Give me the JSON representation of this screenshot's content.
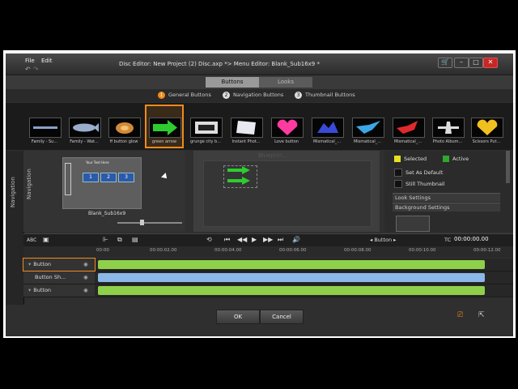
{
  "menu": {
    "file": "File",
    "edit": "Edit"
  },
  "window_title": "Disc Editor: New Project (2) Disc.axp  *>  Menu Editor: Blank_Sub16x9  *",
  "window_controls": {
    "cart": "🛒",
    "minimize": "–",
    "maximize": "□",
    "close": "✕"
  },
  "tabs": [
    {
      "label": "Buttons",
      "active": true
    },
    {
      "label": "Looks",
      "active": false
    }
  ],
  "categories": [
    {
      "num": "1",
      "label": "General Buttons",
      "active": true
    },
    {
      "num": "2",
      "label": "Navigation Buttons",
      "active": false
    },
    {
      "num": "3",
      "label": "Thumbnail Buttons",
      "active": false
    }
  ],
  "gallery": [
    {
      "label": "Family - Su...",
      "icon": "line-icon",
      "color": "#8aa0c8"
    },
    {
      "label": "Family - Wat...",
      "icon": "fish-icon",
      "color": "#9aaccc"
    },
    {
      "label": "ff button glow",
      "icon": "glow-icon",
      "color": "#d08a3a"
    },
    {
      "label": "green arrow",
      "icon": "arrow-icon",
      "color": "#2ecc2e",
      "selected": true
    },
    {
      "label": "grunge city b...",
      "icon": "grunge-icon",
      "color": "#dddddd"
    },
    {
      "label": "Instant Phot...",
      "icon": "photo-icon",
      "color": "#e8e8f0"
    },
    {
      "label": "Love button",
      "icon": "heart-icon",
      "color": "#ff3aa0"
    },
    {
      "label": "Mismatical_...",
      "icon": "splash-icon",
      "color": "#3a4ad8"
    },
    {
      "label": "Mismatical_...",
      "icon": "bird-icon",
      "color": "#3aa8e8"
    },
    {
      "label": "Mismatical_...",
      "icon": "bird-icon",
      "color": "#e02a2a"
    },
    {
      "label": "Photo Album...",
      "icon": "plane-icon",
      "color": "#dddddd"
    },
    {
      "label": "Scissors Put...",
      "icon": "heart-icon",
      "color": "#f0c020"
    }
  ],
  "left_sidebar": {
    "label": "Navigation"
  },
  "nav_panel": {
    "label": "Navigation",
    "preview_title": "Your Text Here",
    "slots": [
      "1",
      "2",
      "3"
    ],
    "thumb_name": "Blank_Sub16x9"
  },
  "stage": {
    "watermark": "Blueprin..."
  },
  "properties": {
    "selected": "Selected",
    "active": "Active",
    "selected_color": "#e8e020",
    "active_color": "#2ea82e",
    "set_default": "Set As Default",
    "still_thumbnail": "Still Thumbnail",
    "look_settings": "Look Settings",
    "background_settings": "Background Settings"
  },
  "transport": {
    "abc": "ABC",
    "track_selector": "◂ Button ▸",
    "tc_label": "TC",
    "timecode": "00:00:00.00"
  },
  "ruler_ticks": [
    "00:00",
    "00:00:02.00",
    "00:00:04.00",
    "00:00:06.00",
    "00:00:08.00",
    "00:00:10.00",
    "00:00:12.00"
  ],
  "tracks": [
    {
      "label": "Button",
      "bar_color": "#8fd04a"
    },
    {
      "label": "Button Sh...",
      "bar_color": "#8ab8e8"
    },
    {
      "label": "Button",
      "bar_color": "#8fd04a"
    }
  ],
  "footer": {
    "ok": "OK",
    "cancel": "Cancel"
  }
}
